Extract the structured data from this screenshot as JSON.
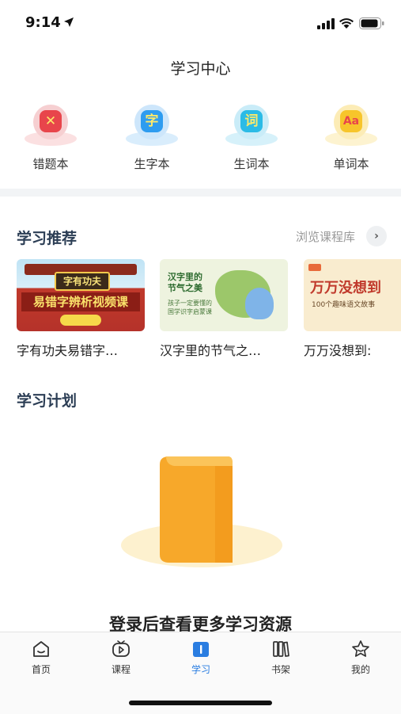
{
  "status_bar": {
    "time": "9:14"
  },
  "header": {
    "title": "学习中心"
  },
  "shortcuts": [
    {
      "label": "错题本",
      "glyph": "✕",
      "color": "#e8454b",
      "icon": "wrong-questions-icon"
    },
    {
      "label": "生字本",
      "glyph": "字",
      "color": "#2e9cf0",
      "icon": "new-characters-icon"
    },
    {
      "label": "生词本",
      "glyph": "词",
      "color": "#2bbbe6",
      "icon": "new-words-icon"
    },
    {
      "label": "单词本",
      "glyph": "Aa",
      "color": "#f7c52b",
      "icon": "vocabulary-icon"
    }
  ],
  "recommend": {
    "title": "学习推荐",
    "browse_label": "浏览课程库",
    "courses": [
      {
        "title": "字有功夫易错字…",
        "thumb_line1": "字有功夫",
        "thumb_line2": "易错字辨析视频课"
      },
      {
        "title": "汉字里的节气之…",
        "thumb_line1": "汉字里的",
        "thumb_line2": "节气之美",
        "thumb_line3": "孩子一定要懂的",
        "thumb_line4": "国学识字启蒙课"
      },
      {
        "title": "万万没想到:",
        "thumb_line1": "万万没想到",
        "thumb_line2": "100个趣味语文故事"
      }
    ]
  },
  "plan": {
    "title": "学习计划",
    "empty_text": "登录后查看更多学习资源"
  },
  "tabs": [
    {
      "label": "首页",
      "icon": "home-icon",
      "active": false
    },
    {
      "label": "课程",
      "icon": "play-icon",
      "active": false
    },
    {
      "label": "学习",
      "icon": "book-icon",
      "active": true
    },
    {
      "label": "书架",
      "icon": "bookshelf-icon",
      "active": false
    },
    {
      "label": "我的",
      "icon": "star-profile-icon",
      "active": false
    }
  ],
  "colors": {
    "accent": "#2a7de1",
    "section_title": "#2c3e55",
    "book_orange": "#f7a82a",
    "book_shadow": "#fdf1cf"
  }
}
